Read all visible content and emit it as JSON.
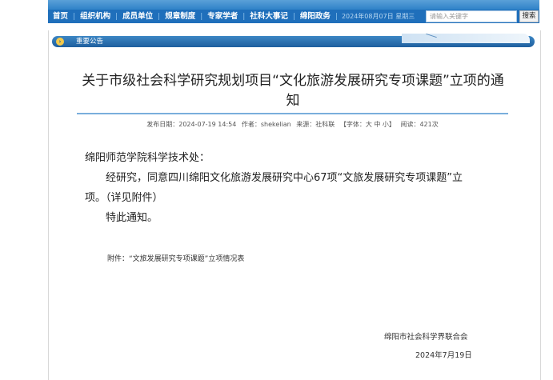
{
  "nav": {
    "items": [
      "首页",
      "组织机构",
      "成员单位",
      "规章制度",
      "专家学者",
      "社科大事记",
      "绵阳政务"
    ],
    "date": "2024年08月07日 星期三",
    "search_placeholder": "请输入关键字",
    "search_button": "搜索"
  },
  "section": {
    "title": "重要公告"
  },
  "article": {
    "title": "关于市级社会科学研究规划项目“文化旅游发展研究专项课题”立项的通知",
    "meta": {
      "publish_date": "发布日期：2024-07-19 14:54",
      "author": "作者：shekelian",
      "source": "来源：社科联",
      "font_size": "【字体：大 中 小】",
      "views": "阅读：421次"
    },
    "salutation": "绵阳师范学院科学技术处：",
    "paragraph_1_line_1": "经研究，同意四川绵阳文化旅游发展研究中心67项“文旅发展研究专项课题”立",
    "paragraph_1_line_2": "项。（详见附件）",
    "paragraph_2": "特此通知。",
    "attachment": "附件：“文旅发展研究专项课题”立项情况表",
    "signature_org": "绵阳市社会科学界联合会",
    "signature_date": "2024年7月19日"
  }
}
